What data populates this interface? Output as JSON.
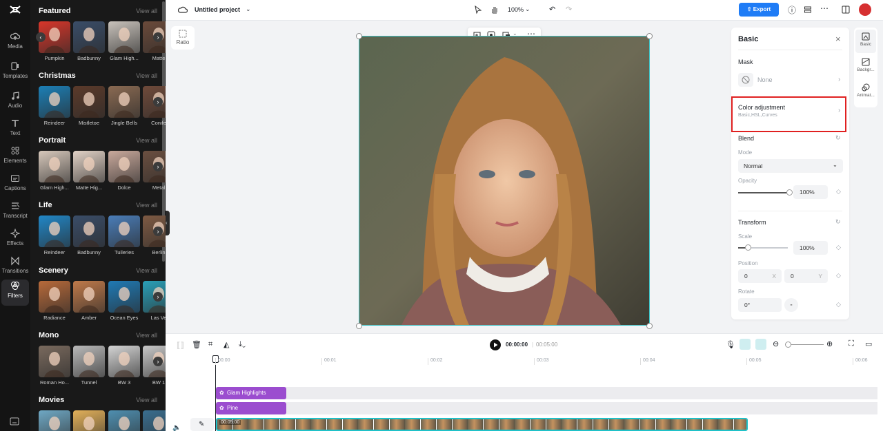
{
  "rail": {
    "logo": "CapCut",
    "items": [
      {
        "label": "Media",
        "icon": "cloud-upload-icon"
      },
      {
        "label": "Templates",
        "icon": "templates-icon"
      },
      {
        "label": "Audio",
        "icon": "music-note-icon"
      },
      {
        "label": "Text",
        "icon": "text-T-icon"
      },
      {
        "label": "Elements",
        "icon": "elements-icon"
      },
      {
        "label": "Captions",
        "icon": "captions-icon"
      },
      {
        "label": "Transcript",
        "icon": "transcript-icon"
      },
      {
        "label": "Effects",
        "icon": "sparkle-icon"
      },
      {
        "label": "Transitions",
        "icon": "bowtie-icon"
      },
      {
        "label": "Filters",
        "icon": "filters-icon",
        "active": true
      }
    ]
  },
  "panel": {
    "view_all": "View all",
    "sections": [
      {
        "title": "Featured",
        "items": [
          "Pumpkin",
          "Badbunny",
          "Glam High...",
          "Matte"
        ]
      },
      {
        "title": "Christmas",
        "items": [
          "Reindeer",
          "Mistletoe",
          "Jingle Bells",
          "Conife"
        ]
      },
      {
        "title": "Portrait",
        "items": [
          "Glam High...",
          "Matte Hig...",
          "Dolce",
          "Metal"
        ]
      },
      {
        "title": "Life",
        "items": [
          "Reindeer",
          "Badbunny",
          "Tuileries",
          "Berlin"
        ]
      },
      {
        "title": "Scenery",
        "items": [
          "Radiance",
          "Amber",
          "Ocean Eyes",
          "Las Ve"
        ]
      },
      {
        "title": "Mono",
        "items": [
          "Roman Ho...",
          "Tunnel",
          "BW 3",
          "BW 1"
        ]
      },
      {
        "title": "Movies",
        "items": []
      }
    ]
  },
  "topbar": {
    "project_title": "Untitled project",
    "zoom": "100%",
    "export_label": "Export"
  },
  "canvas": {
    "ratio_label": "Ratio"
  },
  "props": {
    "title": "Basic",
    "mask_label": "Mask",
    "mask_value": "None",
    "color_adj_label": "Color adjustment",
    "color_adj_sub": "Basic,HSL,Curves",
    "blend_label": "Blend",
    "mode_label": "Mode",
    "mode_value": "Normal",
    "opacity_label": "Opacity",
    "opacity_value": "100%",
    "opacity_fraction": 1.0,
    "transform_label": "Transform",
    "scale_label": "Scale",
    "scale_value": "100%",
    "position_label": "Position",
    "pos_x": "0",
    "pos_x_axis": "X",
    "pos_y": "0",
    "pos_y_axis": "Y",
    "rotate_label": "Rotate",
    "rotate_value": "0°",
    "side_tabs": [
      "Basic",
      "Backgr...",
      "Animat..."
    ]
  },
  "timeline": {
    "current_time": "00:00:00",
    "total_time": "00:05:00",
    "ruler": [
      "00:00",
      "00:01",
      "00:02",
      "00:03",
      "00:04",
      "00:05",
      "00:06"
    ],
    "clips": [
      "Glam Highlights",
      "Pine"
    ],
    "video_clip_duration": "00:05:00"
  },
  "colors": {
    "accent": "#1f7cf6",
    "clip": "#9b4dcf",
    "selection": "#1fc1c8",
    "highlight": "#e02020"
  }
}
